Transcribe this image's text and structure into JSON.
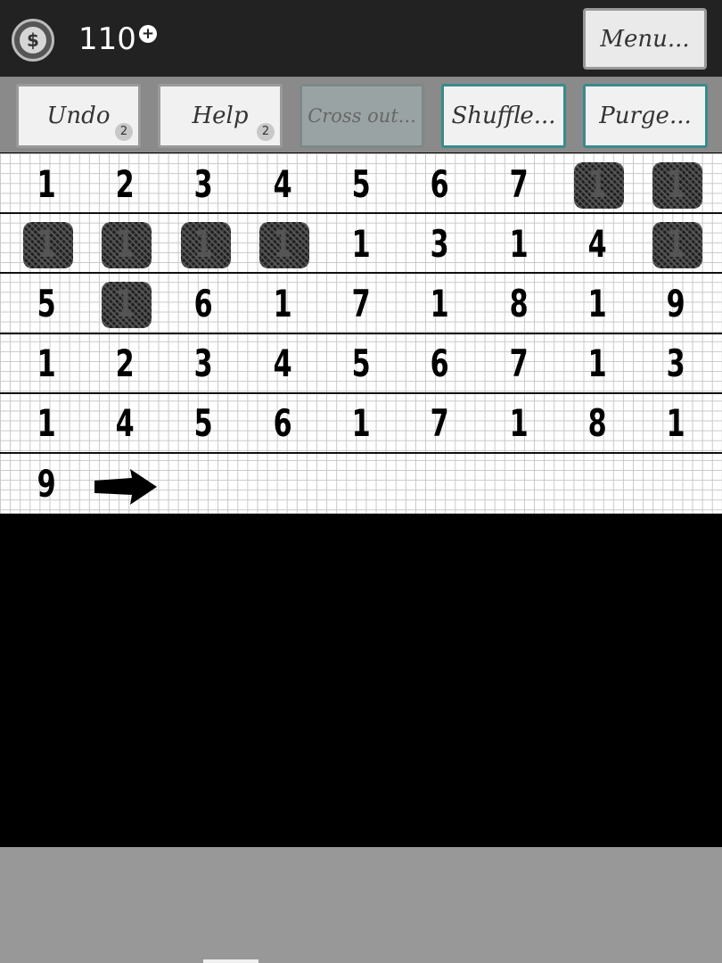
{
  "header": {
    "coin_symbol": "$",
    "coins": "110",
    "coin_plus": "+",
    "menu_label": "Menu..."
  },
  "toolbar": {
    "undo": {
      "label": "Undo",
      "count": "2"
    },
    "help": {
      "label": "Help",
      "count": "2"
    },
    "cross_out": {
      "label": "Cross out..."
    },
    "shuffle": {
      "label": "Shuffle..."
    },
    "purge": {
      "label": "Purge..."
    }
  },
  "board": {
    "rows": [
      [
        "1",
        "2",
        "3",
        "4",
        "5",
        "6",
        "7",
        "1",
        "1"
      ],
      [
        "1",
        "1",
        "1",
        "1",
        "1",
        "3",
        "1",
        "4",
        "1"
      ],
      [
        "5",
        "1",
        "6",
        "1",
        "7",
        "1",
        "8",
        "1",
        "9"
      ],
      [
        "1",
        "2",
        "3",
        "4",
        "5",
        "6",
        "7",
        "1",
        "3"
      ],
      [
        "1",
        "4",
        "5",
        "6",
        "1",
        "7",
        "1",
        "8",
        "1"
      ],
      [
        "9"
      ]
    ],
    "crossed": [
      [
        0,
        7
      ],
      [
        0,
        8
      ],
      [
        1,
        0
      ],
      [
        1,
        1
      ],
      [
        1,
        2
      ],
      [
        1,
        3
      ],
      [
        1,
        8
      ],
      [
        2,
        1
      ]
    ],
    "next_icon": "arrow-right-icon"
  },
  "colors": {
    "topbar": "#222222",
    "toolbar": "#8a8a8a",
    "teal_border": "#3a8a8c",
    "bottom_area": "#989898"
  }
}
